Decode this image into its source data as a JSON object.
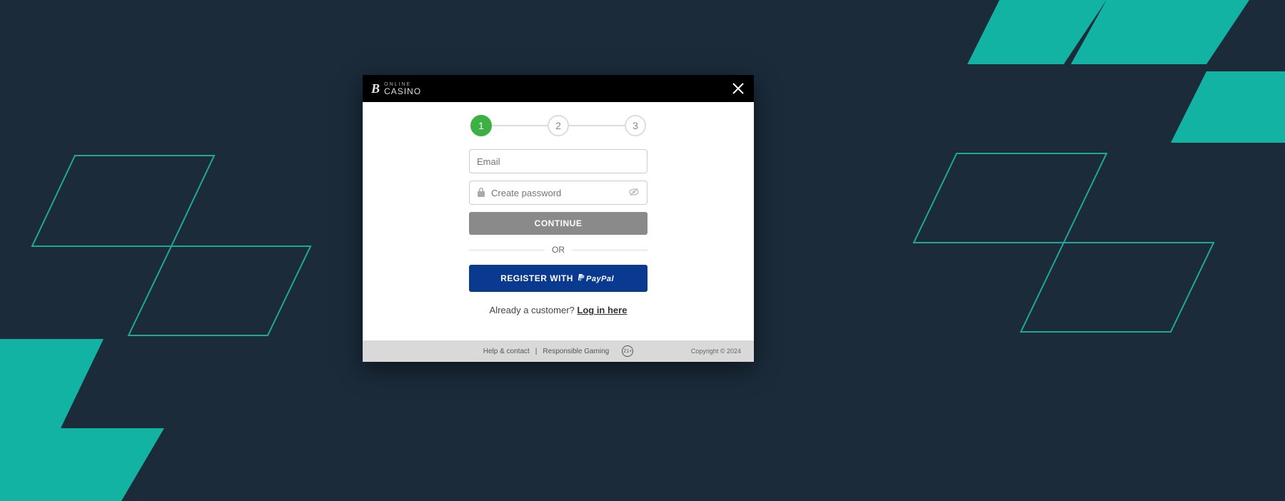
{
  "brand": {
    "top": "ONLINE",
    "bottom": "CASINO"
  },
  "stepper": {
    "step1": "1",
    "step2": "2",
    "step3": "3"
  },
  "form": {
    "email_placeholder": "Email",
    "password_placeholder": "Create password",
    "continue_label": "CONTINUE",
    "or_label": "OR",
    "paypal_label": "REGISTER WITH"
  },
  "already": {
    "text": "Already a customer? ",
    "link": "Log in here"
  },
  "footer": {
    "help": "Help & contact",
    "sep": "|",
    "responsible": "Responsible Gaming",
    "age": "21+",
    "copyright": "Copyright © 2024"
  }
}
